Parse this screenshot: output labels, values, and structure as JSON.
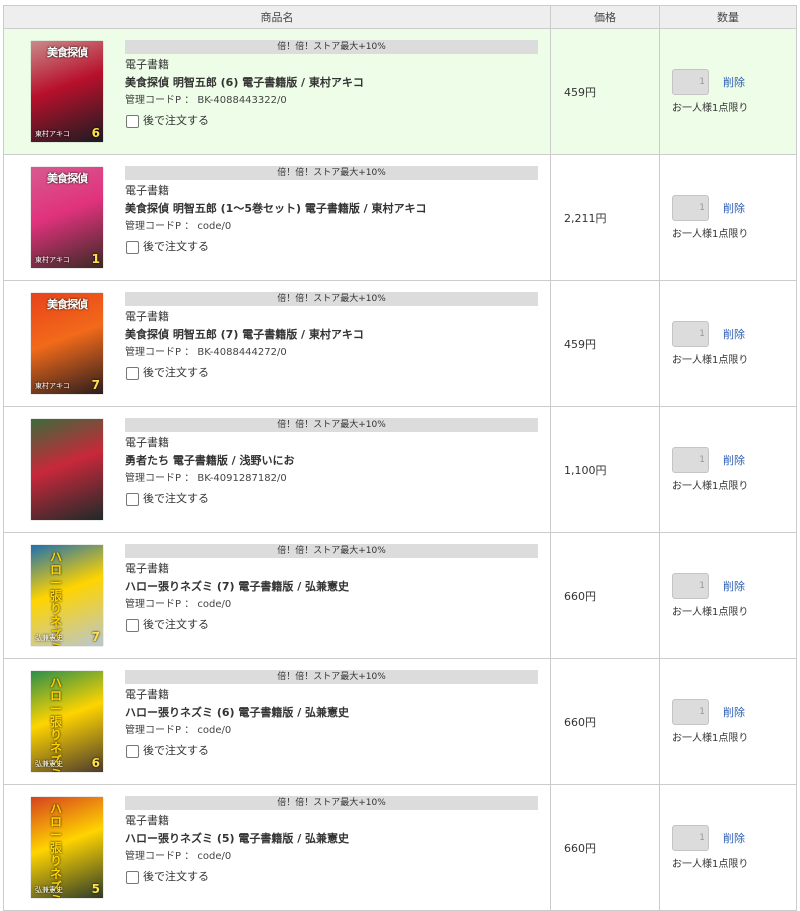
{
  "headers": {
    "product": "商品名",
    "price": "価格",
    "quantity": "数量"
  },
  "colors": {
    "highlight_row": "#eefde8",
    "promo_bg": "#dcdcdc",
    "link": "#2a5db0"
  },
  "items": [
    {
      "promo": "倍！倍！ストア最大+10%",
      "category": "電子書籍",
      "title": "美食探偵 明智五郎 (6) 電子書籍版 / 東村アキコ",
      "code": "管理コードP ： BK-4088443322/0",
      "order_later": "後で注文する",
      "price": "459円",
      "qty": "1",
      "delete": "削除",
      "limit": "お一人様1点限り",
      "cover": {
        "title": "美食探偵",
        "volume": "6",
        "author": "東村アキコ",
        "bg1": "#c98a8a",
        "bg2": "#1b1c22",
        "accent": "#b8102b"
      }
    },
    {
      "promo": "倍！倍！ストア最大+10%",
      "category": "電子書籍",
      "title": "美食探偵 明智五郎 (1～5巻セット) 電子書籍版 / 東村アキコ",
      "code": "管理コードP ： code/0",
      "order_later": "後で注文する",
      "price": "2,211円",
      "qty": "1",
      "delete": "削除",
      "limit": "お一人様1点限り",
      "cover": {
        "title": "美食探偵",
        "volume": "1",
        "author": "東村アキコ",
        "bg1": "#d85a8f",
        "bg2": "#3a2a24",
        "accent": "#e0327c"
      }
    },
    {
      "promo": "倍！倍！ストア最大+10%",
      "category": "電子書籍",
      "title": "美食探偵 明智五郎 (7) 電子書籍版 / 東村アキコ",
      "code": "管理コードP ： BK-4088444272/0",
      "order_later": "後で注文する",
      "price": "459円",
      "qty": "1",
      "delete": "削除",
      "limit": "お一人様1点限り",
      "cover": {
        "title": "美食探偵",
        "volume": "7",
        "author": "東村アキコ",
        "bg1": "#e8421b",
        "bg2": "#2b1d1d",
        "accent": "#f26a1a"
      }
    },
    {
      "promo": "倍！倍！ストア最大+10%",
      "category": "電子書籍",
      "title": "勇者たち 電子書籍版 / 浅野いにお",
      "code": "管理コードP ： BK-4091287182/0",
      "order_later": "後で注文する",
      "price": "1,100円",
      "qty": "1",
      "delete": "削除",
      "limit": "お一人様1点限り",
      "cover": {
        "title": "",
        "volume": "",
        "author": "",
        "bg1": "#3d6b3a",
        "bg2": "#1e2a2a",
        "accent": "#c8283a"
      }
    },
    {
      "promo": "倍！倍！ストア最大+10%",
      "category": "電子書籍",
      "title": "ハロー張りネズミ (7) 電子書籍版 / 弘兼憲史",
      "code": "管理コードP ： code/0",
      "order_later": "後で注文する",
      "price": "660円",
      "qty": "1",
      "delete": "削除",
      "limit": "お一人様1点限り",
      "cover": {
        "title": "ハロー張りネズミ",
        "volume": "7",
        "author": "弘兼憲史",
        "bg1": "#1d6fb0",
        "bg2": "#b9c7cf",
        "accent": "#ffd400"
      }
    },
    {
      "promo": "倍！倍！ストア最大+10%",
      "category": "電子書籍",
      "title": "ハロー張りネズミ (6) 電子書籍版 / 弘兼憲史",
      "code": "管理コードP ： code/0",
      "order_later": "後で注文する",
      "price": "660円",
      "qty": "1",
      "delete": "削除",
      "limit": "お一人様1点限り",
      "cover": {
        "title": "ハロー張りネズミ",
        "volume": "6",
        "author": "弘兼憲史",
        "bg1": "#2a8f4a",
        "bg2": "#4b3b2e",
        "accent": "#ffd400"
      }
    },
    {
      "promo": "倍！倍！ストア最大+10%",
      "category": "電子書籍",
      "title": "ハロー張りネズミ (5) 電子書籍版 / 弘兼憲史",
      "code": "管理コードP ： code/0",
      "order_later": "後で注文する",
      "price": "660円",
      "qty": "1",
      "delete": "削除",
      "limit": "お一人様1点限り",
      "cover": {
        "title": "ハロー張りネズミ",
        "volume": "5",
        "author": "弘兼憲史",
        "bg1": "#d6411f",
        "bg2": "#2c3b2a",
        "accent": "#ffd400"
      }
    }
  ]
}
